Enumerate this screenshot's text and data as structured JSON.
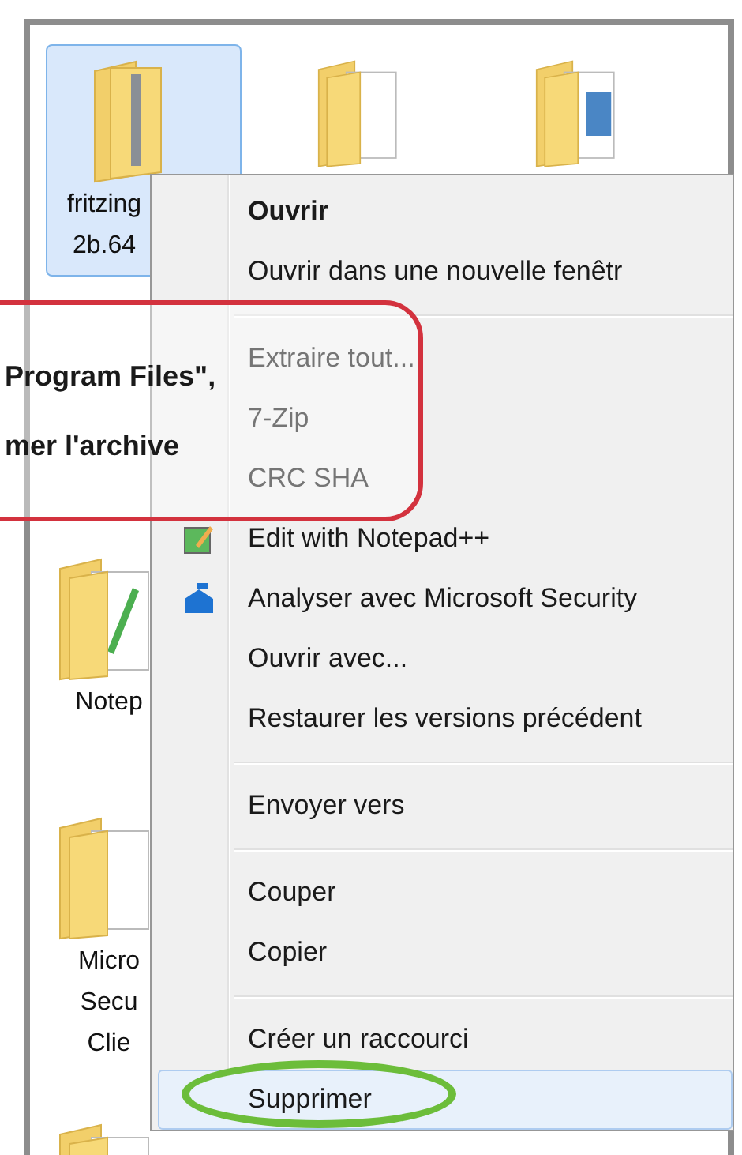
{
  "files": [
    {
      "kind": "zip",
      "selected": true,
      "label_lines": [
        "fritzing",
        "2b.64"
      ]
    },
    {
      "kind": "docs",
      "selected": false
    },
    {
      "kind": "pictures",
      "selected": false
    },
    {
      "kind": "notepad",
      "selected": false,
      "label_lines": [
        "Notep"
      ]
    },
    {
      "kind": "docs",
      "selected": false,
      "label_lines": [
        "Micro",
        "Secu",
        "Clie"
      ]
    },
    {
      "kind": "docs",
      "selected": false
    }
  ],
  "context_menu": {
    "groups": [
      [
        {
          "label": "Ouvrir",
          "kind": "text",
          "default": true,
          "selected": false
        },
        {
          "label": "Ouvrir dans une nouvelle fenêtr",
          "kind": "text",
          "default": false,
          "selected": false
        }
      ],
      [
        {
          "label": "Extraire tout...",
          "kind": "text",
          "default": false,
          "selected": false
        },
        {
          "label": "7-Zip",
          "kind": "text",
          "default": false,
          "selected": false
        },
        {
          "label": "CRC SHA",
          "kind": "text",
          "default": false,
          "selected": false
        },
        {
          "label": "Edit with Notepad++",
          "kind": "notepad",
          "default": false,
          "selected": false
        },
        {
          "label": "Analyser avec Microsoft Security",
          "kind": "security",
          "default": false,
          "selected": false
        },
        {
          "label": "Ouvrir avec...",
          "kind": "text",
          "default": false,
          "selected": false
        },
        {
          "label": "Restaurer les versions précédent",
          "kind": "text",
          "default": false,
          "selected": false
        }
      ],
      [
        {
          "label": "Envoyer vers",
          "kind": "text",
          "default": false,
          "selected": false
        }
      ],
      [
        {
          "label": "Couper",
          "kind": "text",
          "default": false,
          "selected": false
        },
        {
          "label": "Copier",
          "kind": "text",
          "default": false,
          "selected": false
        }
      ],
      [
        {
          "label": "Créer un raccourci",
          "kind": "text",
          "default": false,
          "selected": false
        },
        {
          "label": "Supprimer",
          "kind": "text",
          "default": false,
          "selected": true
        }
      ]
    ]
  },
  "callout": {
    "lines": [
      "Program Files\",",
      "mer l'archive"
    ]
  }
}
